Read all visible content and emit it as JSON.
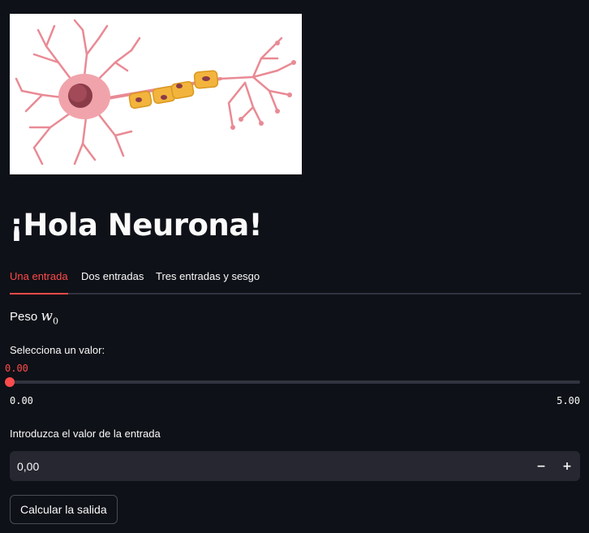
{
  "page": {
    "title": "¡Hola Neurona!"
  },
  "tabs": [
    {
      "label": "Una entrada",
      "active": true
    },
    {
      "label": "Dos entradas",
      "active": false
    },
    {
      "label": "Tres entradas y sesgo",
      "active": false
    }
  ],
  "weight": {
    "label": "Peso",
    "symbol": "w",
    "subscript": "0"
  },
  "slider": {
    "label": "Selecciona un valor:",
    "value_text": "0.00",
    "value": 0.0,
    "min_text": "0.00",
    "max_text": "5.00",
    "min": 0.0,
    "max": 5.0
  },
  "number_input": {
    "label": "Introduzca el valor de la entrada",
    "value": "0,00",
    "minus_label": "−",
    "plus_label": "+"
  },
  "button": {
    "label": "Calcular la salida"
  },
  "colors": {
    "background": "#0e1117",
    "accent": "#ff4b4b",
    "text": "#fafafa",
    "input_bg": "#262730"
  }
}
